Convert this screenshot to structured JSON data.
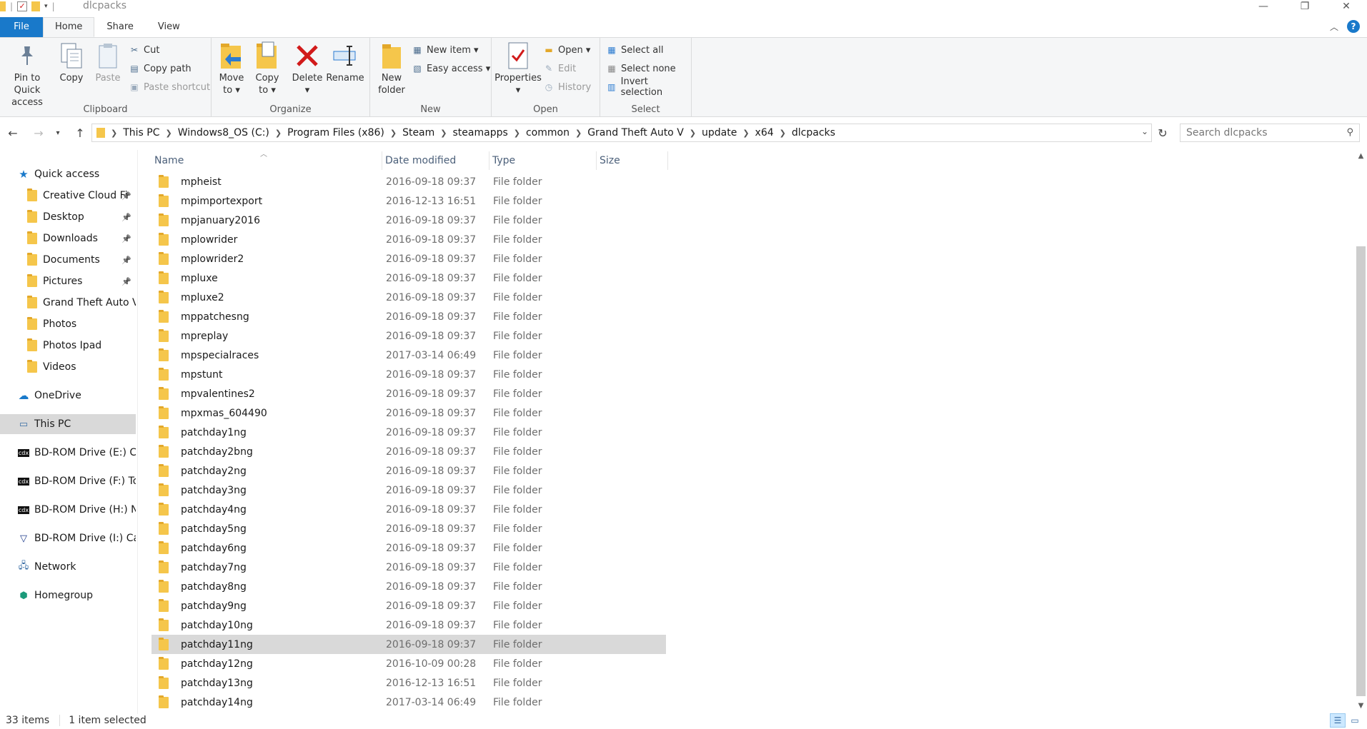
{
  "window": {
    "title": "dlcpacks",
    "minimize": "—",
    "restore": "❐",
    "close": "✕"
  },
  "ribbon_tabs": {
    "file": "File",
    "home": "Home",
    "share": "Share",
    "view": "View"
  },
  "ribbon": {
    "clipboard": {
      "label": "Clipboard",
      "pin": "Pin to Quick access",
      "pin_l1": "Pin to Quick",
      "pin_l2": "access",
      "copy": "Copy",
      "paste": "Paste",
      "cut": "Cut",
      "copy_path": "Copy path",
      "paste_shortcut": "Paste shortcut"
    },
    "organize": {
      "label": "Organize",
      "move_l1": "Move",
      "move_l2": "to ▾",
      "copy_l1": "Copy",
      "copy_l2": "to ▾",
      "delete_l1": "Delete",
      "delete_l2": "▾",
      "rename": "Rename"
    },
    "new": {
      "label": "New",
      "new_folder_l1": "New",
      "new_folder_l2": "folder",
      "new_item": "New item ▾",
      "easy_access": "Easy access ▾"
    },
    "open": {
      "label": "Open",
      "properties_l1": "Properties",
      "properties_l2": "▾",
      "open": "Open ▾",
      "edit": "Edit",
      "history": "History"
    },
    "select": {
      "label": "Select",
      "select_all": "Select all",
      "select_none": "Select none",
      "invert": "Invert selection"
    }
  },
  "address": {
    "crumbs": [
      "This PC",
      "Windows8_OS (C:)",
      "Program Files (x86)",
      "Steam",
      "steamapps",
      "common",
      "Grand Theft Auto V",
      "update",
      "x64",
      "dlcpacks"
    ],
    "search_placeholder": "Search dlcpacks"
  },
  "nav": {
    "quick_access": "Quick access",
    "items": [
      {
        "label": "Creative Cloud Fi",
        "pinned": true
      },
      {
        "label": "Desktop",
        "pinned": true
      },
      {
        "label": "Downloads",
        "pinned": true
      },
      {
        "label": "Documents",
        "pinned": true
      },
      {
        "label": "Pictures",
        "pinned": true
      },
      {
        "label": "Grand Theft Auto V",
        "pinned": false
      },
      {
        "label": "Photos",
        "pinned": false
      },
      {
        "label": "Photos Ipad",
        "pinned": false
      },
      {
        "label": "Videos",
        "pinned": false
      }
    ],
    "onedrive": "OneDrive",
    "this_pc": "This PC",
    "drives": [
      "BD-ROM Drive (E:) Ci",
      "BD-ROM Drive (F:) To",
      "BD-ROM Drive (H:) N",
      "BD-ROM Drive (I:) Ca"
    ],
    "network": "Network",
    "homegroup": "Homegroup"
  },
  "columns": {
    "name": "Name",
    "date": "Date modified",
    "type": "Type",
    "size": "Size"
  },
  "files": [
    {
      "name": "mpheist",
      "date": "2016-09-18 09:37",
      "type": "File folder"
    },
    {
      "name": "mpimportexport",
      "date": "2016-12-13 16:51",
      "type": "File folder"
    },
    {
      "name": "mpjanuary2016",
      "date": "2016-09-18 09:37",
      "type": "File folder"
    },
    {
      "name": "mplowrider",
      "date": "2016-09-18 09:37",
      "type": "File folder"
    },
    {
      "name": "mplowrider2",
      "date": "2016-09-18 09:37",
      "type": "File folder"
    },
    {
      "name": "mpluxe",
      "date": "2016-09-18 09:37",
      "type": "File folder"
    },
    {
      "name": "mpluxe2",
      "date": "2016-09-18 09:37",
      "type": "File folder"
    },
    {
      "name": "mppatchesng",
      "date": "2016-09-18 09:37",
      "type": "File folder"
    },
    {
      "name": "mpreplay",
      "date": "2016-09-18 09:37",
      "type": "File folder"
    },
    {
      "name": "mpspecialraces",
      "date": "2017-03-14 06:49",
      "type": "File folder"
    },
    {
      "name": "mpstunt",
      "date": "2016-09-18 09:37",
      "type": "File folder"
    },
    {
      "name": "mpvalentines2",
      "date": "2016-09-18 09:37",
      "type": "File folder"
    },
    {
      "name": "mpxmas_604490",
      "date": "2016-09-18 09:37",
      "type": "File folder"
    },
    {
      "name": "patchday1ng",
      "date": "2016-09-18 09:37",
      "type": "File folder"
    },
    {
      "name": "patchday2bng",
      "date": "2016-09-18 09:37",
      "type": "File folder"
    },
    {
      "name": "patchday2ng",
      "date": "2016-09-18 09:37",
      "type": "File folder"
    },
    {
      "name": "patchday3ng",
      "date": "2016-09-18 09:37",
      "type": "File folder"
    },
    {
      "name": "patchday4ng",
      "date": "2016-09-18 09:37",
      "type": "File folder"
    },
    {
      "name": "patchday5ng",
      "date": "2016-09-18 09:37",
      "type": "File folder"
    },
    {
      "name": "patchday6ng",
      "date": "2016-09-18 09:37",
      "type": "File folder"
    },
    {
      "name": "patchday7ng",
      "date": "2016-09-18 09:37",
      "type": "File folder"
    },
    {
      "name": "patchday8ng",
      "date": "2016-09-18 09:37",
      "type": "File folder"
    },
    {
      "name": "patchday9ng",
      "date": "2016-09-18 09:37",
      "type": "File folder"
    },
    {
      "name": "patchday10ng",
      "date": "2016-09-18 09:37",
      "type": "File folder"
    },
    {
      "name": "patchday11ng",
      "date": "2016-09-18 09:37",
      "type": "File folder",
      "selected": true
    },
    {
      "name": "patchday12ng",
      "date": "2016-10-09 00:28",
      "type": "File folder"
    },
    {
      "name": "patchday13ng",
      "date": "2016-12-13 16:51",
      "type": "File folder"
    },
    {
      "name": "patchday14ng",
      "date": "2017-03-14 06:49",
      "type": "File folder"
    }
  ],
  "status": {
    "count": "33 items",
    "selected": "1 item selected"
  },
  "colors": {
    "accent": "#1979ca",
    "folder": "#f5c64b",
    "selection": "#d9d9d9",
    "delete_red": "#d11a1a"
  }
}
